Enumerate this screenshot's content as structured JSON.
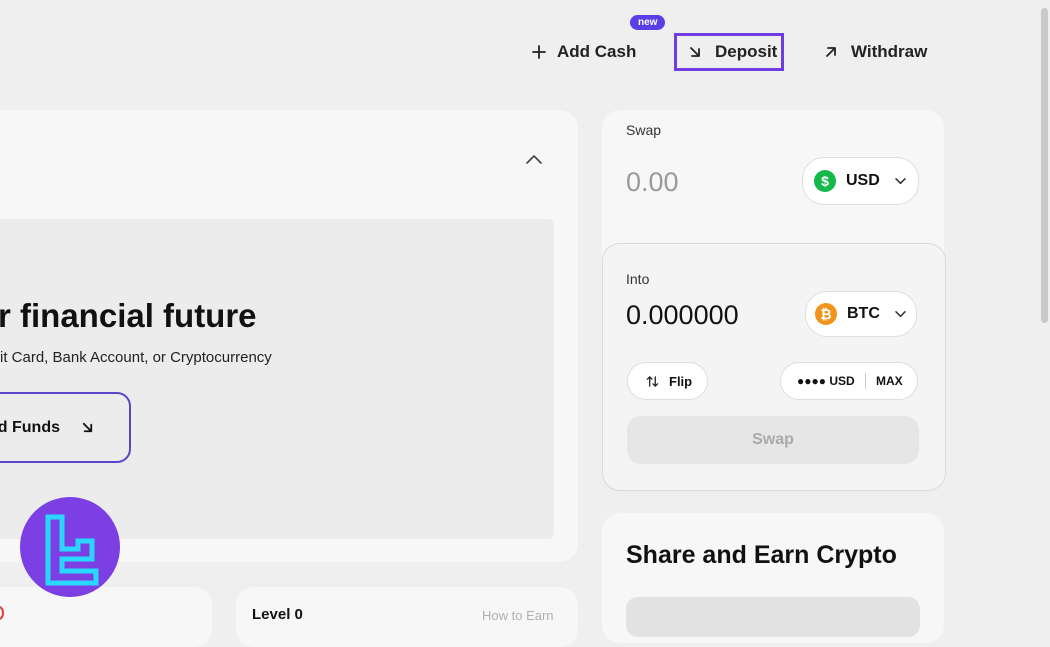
{
  "header": {
    "add_cash": "Add Cash",
    "deposit": "Deposit",
    "withdraw": "Withdraw",
    "new_badge": "new"
  },
  "hero": {
    "title": "r financial future",
    "subtitle": "it Card, Bank Account, or Cryptocurrency",
    "button": "dd Funds"
  },
  "swap": {
    "label": "Swap",
    "amount": "0.00",
    "currency": "USD",
    "into_label": "Into",
    "into_amount": "0.000000",
    "into_currency": "BTC",
    "flip": "Flip",
    "balance_mask": "●●●● USD",
    "max": "MAX",
    "swap_button": "Swap"
  },
  "share": {
    "title": "Share and Earn Crypto"
  },
  "bottom": {
    "level": "Level 0",
    "how_to_earn": "How to Earn"
  },
  "colors": {
    "accent": "#6f3ee0",
    "usd": "#15b84a",
    "btc": "#f2931a"
  }
}
